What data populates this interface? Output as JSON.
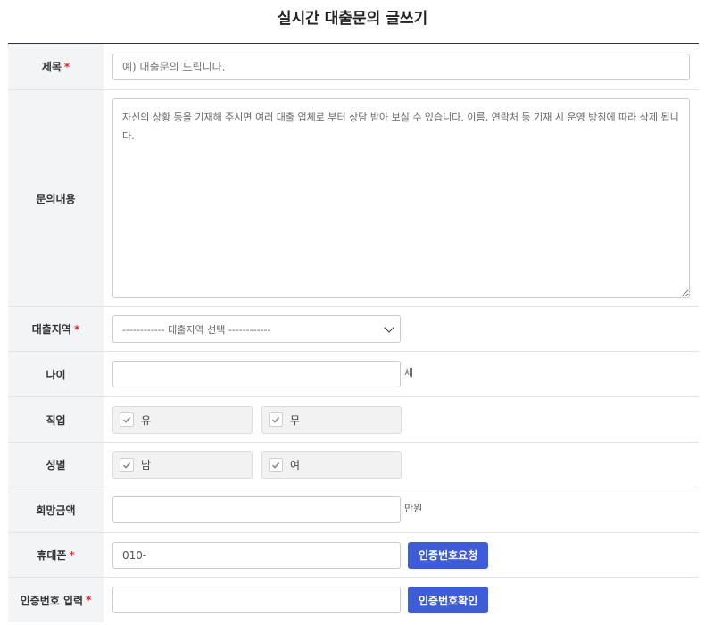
{
  "page": {
    "title": "실시간 대출문의 글쓰기"
  },
  "form": {
    "title": {
      "label": "제목",
      "required": "*",
      "placeholder": "예) 대출문의 드립니다.",
      "value": ""
    },
    "content": {
      "label": "문의내용",
      "placeholder": "자신의 상황 등을 기재해 주시면 여러 대출 업체로 부터 상담 받아 보실 수 있습니다. 이름, 연락처 등 기재 시 운영 방침에 따라 삭제 됩니다."
    },
    "region": {
      "label": "대출지역",
      "required": "*",
      "selected": "------------ 대출지역 선택 ------------"
    },
    "age": {
      "label": "나이",
      "unit": "세",
      "value": ""
    },
    "job": {
      "label": "직업",
      "options": [
        "유",
        "무"
      ]
    },
    "gender": {
      "label": "성별",
      "options": [
        "남",
        "여"
      ]
    },
    "amount": {
      "label": "희망금액",
      "unit": "만원",
      "value": ""
    },
    "phone": {
      "label": "휴대폰",
      "required": "*",
      "value": "010-",
      "button": "인증번호요청"
    },
    "verify": {
      "label": "인증번호 입력",
      "required": "*",
      "value": "",
      "button": "인증번호확인"
    }
  },
  "colors": {
    "accent": "#3f5cd8",
    "required": "#e6232f",
    "label_bg": "#f3f4f6"
  }
}
